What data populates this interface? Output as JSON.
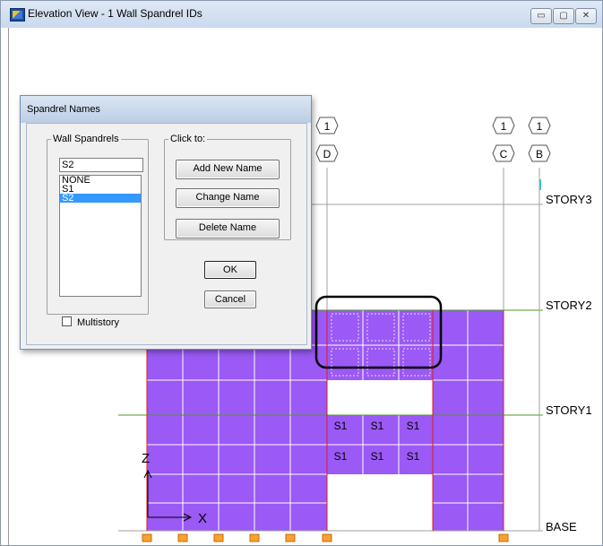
{
  "window": {
    "title": "Elevation View - 1  Wall Spandrel IDs",
    "controls": {
      "minimize": "▭",
      "maximize": "▢",
      "close": "✕"
    }
  },
  "elevation": {
    "stories": [
      "STORY3",
      "STORY2",
      "STORY1",
      "BASE"
    ],
    "grid_bubbles": [
      {
        "top": "1",
        "bottom": "D"
      },
      {
        "top": "1",
        "bottom": "C"
      },
      {
        "top": "1",
        "bottom": "B"
      }
    ],
    "spandrel_labels": [
      "S1",
      "S1",
      "S1",
      "S1",
      "S1",
      "S1"
    ],
    "axis": {
      "z": "Z",
      "x": "X"
    },
    "colors": {
      "wall_fill": "#9b59f5",
      "pier_line": "#e01a1a",
      "story_line": "#4c9a2a"
    }
  },
  "dialog": {
    "title": "Spandrel Names",
    "group_spandrels_label": "Wall Spandrels",
    "name_input_value": "S2",
    "list_items": [
      "NONE",
      "S1",
      "S2"
    ],
    "selected_item": "S2",
    "group_clickto_label": "Click to:",
    "add_button": "Add New Name",
    "change_button": "Change Name",
    "delete_button": "Delete Name",
    "ok_button": "OK",
    "cancel_button": "Cancel",
    "multistory_label": "Multistory"
  }
}
